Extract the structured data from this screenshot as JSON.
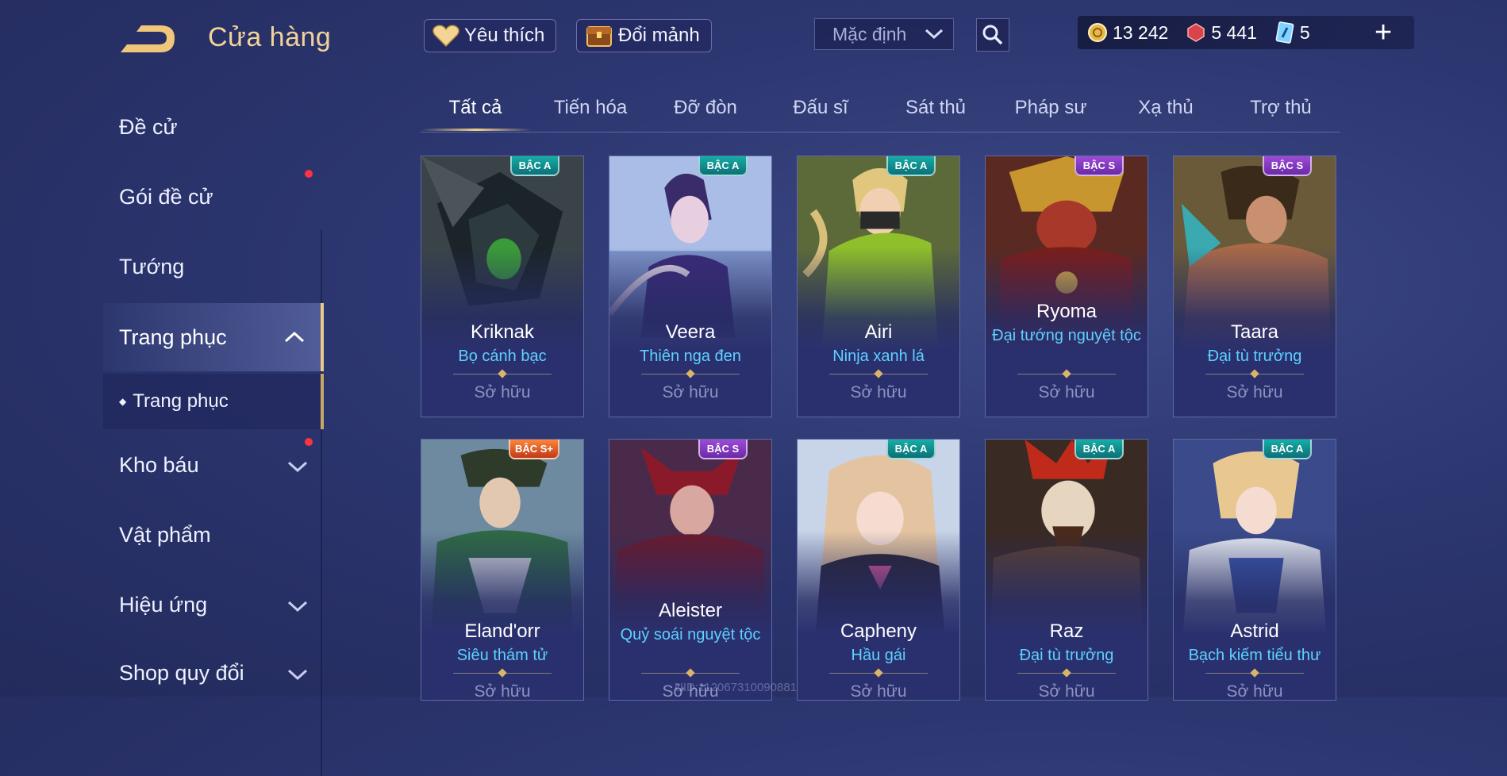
{
  "header": {
    "title": "Cửa hàng",
    "favorite_label": "Yêu thích",
    "exchange_label": "Đổi mảnh",
    "sort_value": "Mặc định",
    "currencies": [
      {
        "icon": "gold-coin-icon",
        "value": "13 242"
      },
      {
        "icon": "voucher-gem-icon",
        "value": "5 441"
      },
      {
        "icon": "skin-card-icon",
        "value": "5"
      }
    ],
    "plus_label": "+"
  },
  "sidebar": {
    "items": [
      {
        "label": "Đề cử"
      },
      {
        "label": "Gói đề cử"
      },
      {
        "label": "Tướng"
      },
      {
        "label": "Trang phục"
      },
      {
        "label": "Kho báu"
      },
      {
        "label": "Vật phẩm"
      },
      {
        "label": "Hiệu ứng"
      },
      {
        "label": "Shop quy đổi"
      }
    ],
    "sub_item": "Trang phục"
  },
  "tabs": [
    "Tất cả",
    "Tiến hóa",
    "Đỡ đòn",
    "Đấu sĩ",
    "Sát thủ",
    "Pháp sư",
    "Xạ thủ",
    "Trợ thủ"
  ],
  "cards": [
    {
      "hero": "Kriknak",
      "skin": "Bọ cánh bạc",
      "tier": "BẬC A",
      "status": "Sở hữu"
    },
    {
      "hero": "Veera",
      "skin": "Thiên nga đen",
      "tier": "BẬC A",
      "status": "Sở hữu"
    },
    {
      "hero": "Airi",
      "skin": "Ninja xanh lá",
      "tier": "BẬC A",
      "status": "Sở hữu"
    },
    {
      "hero": "Ryoma",
      "skin": "Đại tướng nguyệt tộc",
      "tier": "BẬC S",
      "status": "Sở hữu"
    },
    {
      "hero": "Taara",
      "skin": "Đại tù trưởng",
      "tier": "BẬC S",
      "status": "Sở hữu"
    },
    {
      "hero": "Eland'orr",
      "skin": "Siêu thám tử",
      "tier": "BẬC S+",
      "status": "Sở hữu"
    },
    {
      "hero": "Aleister",
      "skin": "Quỷ soái nguyệt tộc",
      "tier": "BẬC S",
      "status": "Sở hữu"
    },
    {
      "hero": "Capheny",
      "skin": "Hầu gái",
      "tier": "BẬC A",
      "status": "Sở hữu"
    },
    {
      "hero": "Raz",
      "skin": "Đại tù trưởng",
      "tier": "BẬC A",
      "status": "Sở hữu"
    },
    {
      "hero": "Astrid",
      "skin": "Bạch kiếm tiểu thư",
      "tier": "BẬC A",
      "status": "Sở hữu"
    }
  ],
  "uid_text": "UID:112067310090881",
  "colors": {
    "accent": "#f1d39a",
    "skin_name": "#5fd0ff",
    "tier_a": "#15b1a8",
    "tier_s": "#a04cd8",
    "tier_splus": "#ff8a3d"
  }
}
